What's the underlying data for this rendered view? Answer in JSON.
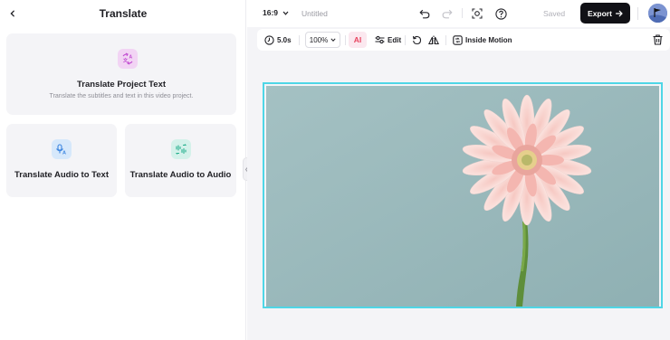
{
  "left_panel": {
    "title": "Translate",
    "cards": {
      "project": {
        "title": "Translate Project Text",
        "desc": "Translate the subtitles and text in this video project."
      },
      "audio_text": {
        "title": "Translate Audio to Text"
      },
      "audio_audio": {
        "title": "Translate Audio to Audio"
      }
    }
  },
  "topbar": {
    "ratio": "16:9",
    "doc_title": "Untitled",
    "saved": "Saved",
    "export": "Export"
  },
  "toolbar": {
    "duration": "5.0s",
    "zoom": "100%",
    "ai_label": "AI",
    "edit": "Edit",
    "inside_motion": "Inside Motion"
  },
  "colors": {
    "accent_cyan": "#4fd6e6",
    "export_bg": "#111116",
    "canvas_bg": "#98b8bb",
    "ai_accent": "#e8445f"
  },
  "icons": [
    "chevron-left-icon",
    "translate-text-icon",
    "mic-translate-icon",
    "audio-translate-icon",
    "chevron-down-icon",
    "undo-icon",
    "redo-icon",
    "screenshot-icon",
    "help-icon",
    "arrow-right-icon",
    "avatar-flag-icon",
    "clock-icon",
    "adjust-icon",
    "rotate-icon",
    "flip-icon",
    "inside-motion-icon",
    "trash-icon"
  ]
}
